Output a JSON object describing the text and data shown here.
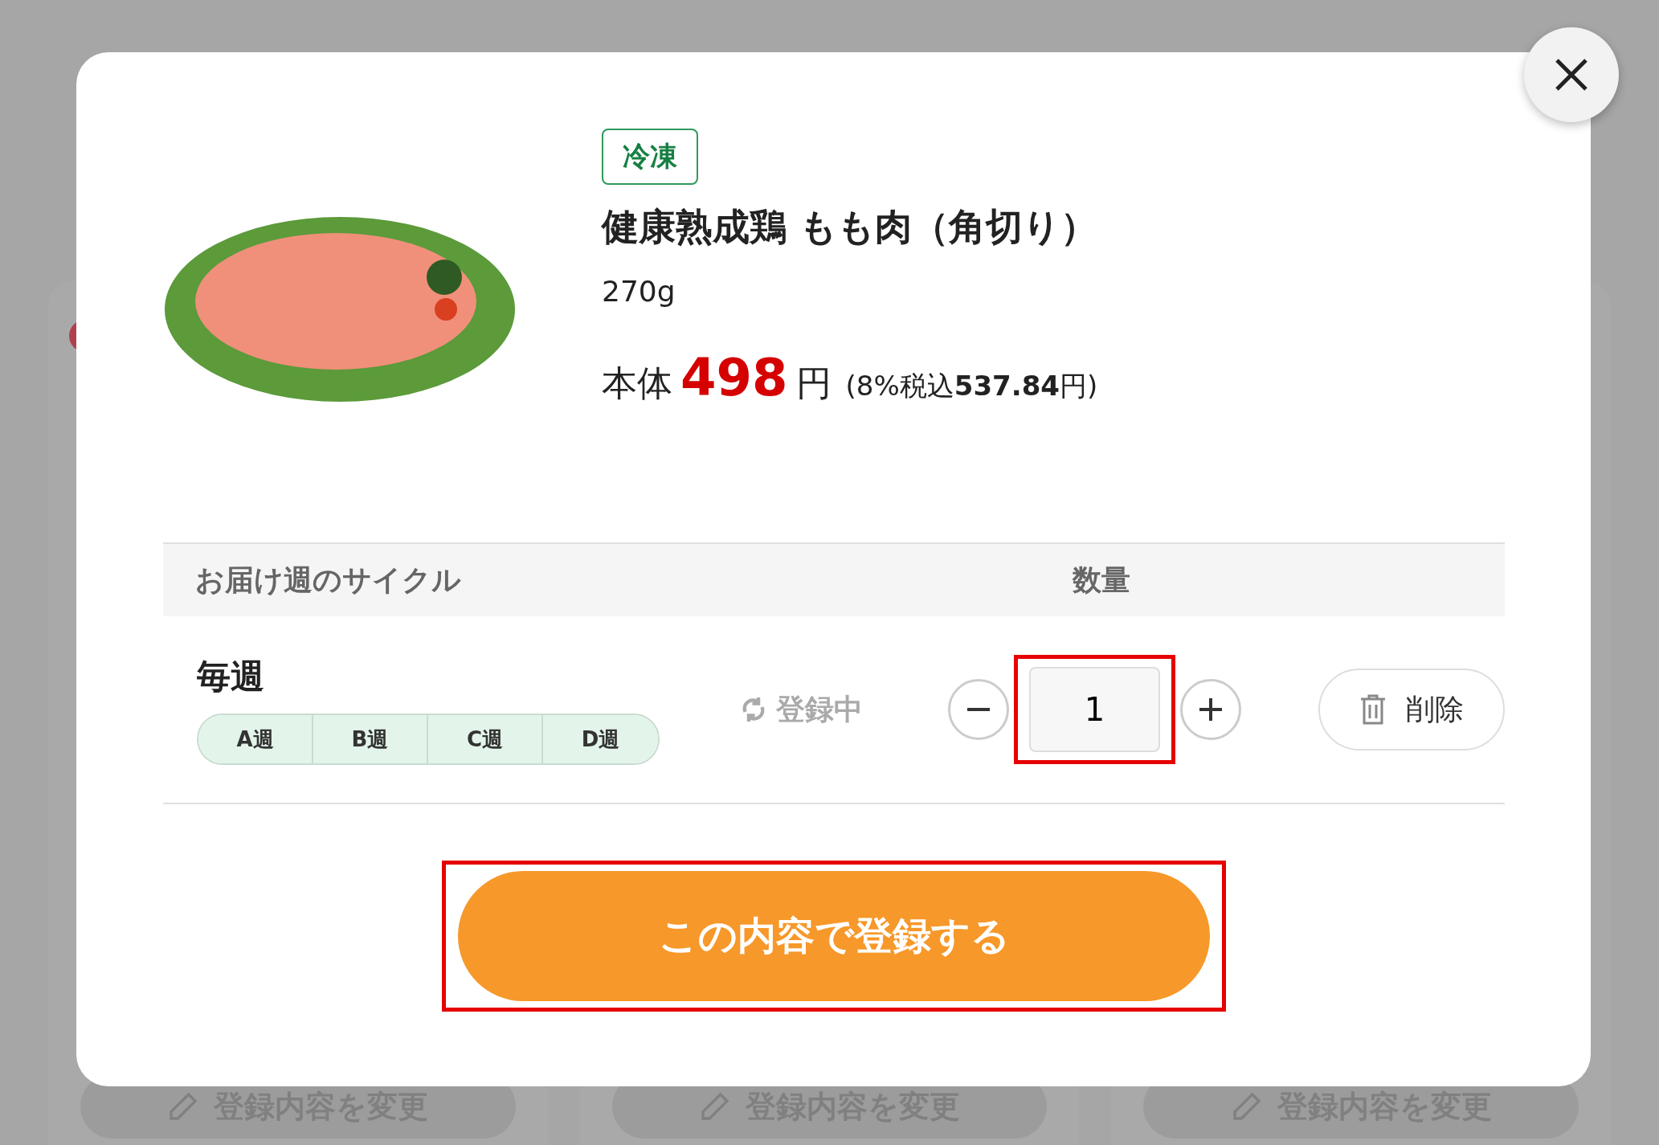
{
  "background": {
    "buttons": [
      "登録内容を変更",
      "登録内容を変更",
      "登録内容を変更"
    ]
  },
  "product": {
    "badge": "冷凍",
    "name": "健康熟成鶏 もも肉（角切り）",
    "weight": "270g",
    "price_label": "本体",
    "price": "498",
    "price_unit": "円",
    "tax_note": "(8%税込**537.84**円)"
  },
  "table": {
    "columns": [
      "お届け週のサイクル",
      "数量"
    ],
    "row": {
      "cycle": "毎週",
      "weeks": [
        {
          "label": "A週",
          "selected": true
        },
        {
          "label": "B週",
          "selected": true
        },
        {
          "label": "C週",
          "selected": true
        },
        {
          "label": "D週",
          "selected": true
        }
      ],
      "status": "登録中",
      "quantity": "1",
      "delete": "削除"
    }
  },
  "submit": "この内容で登録する"
}
